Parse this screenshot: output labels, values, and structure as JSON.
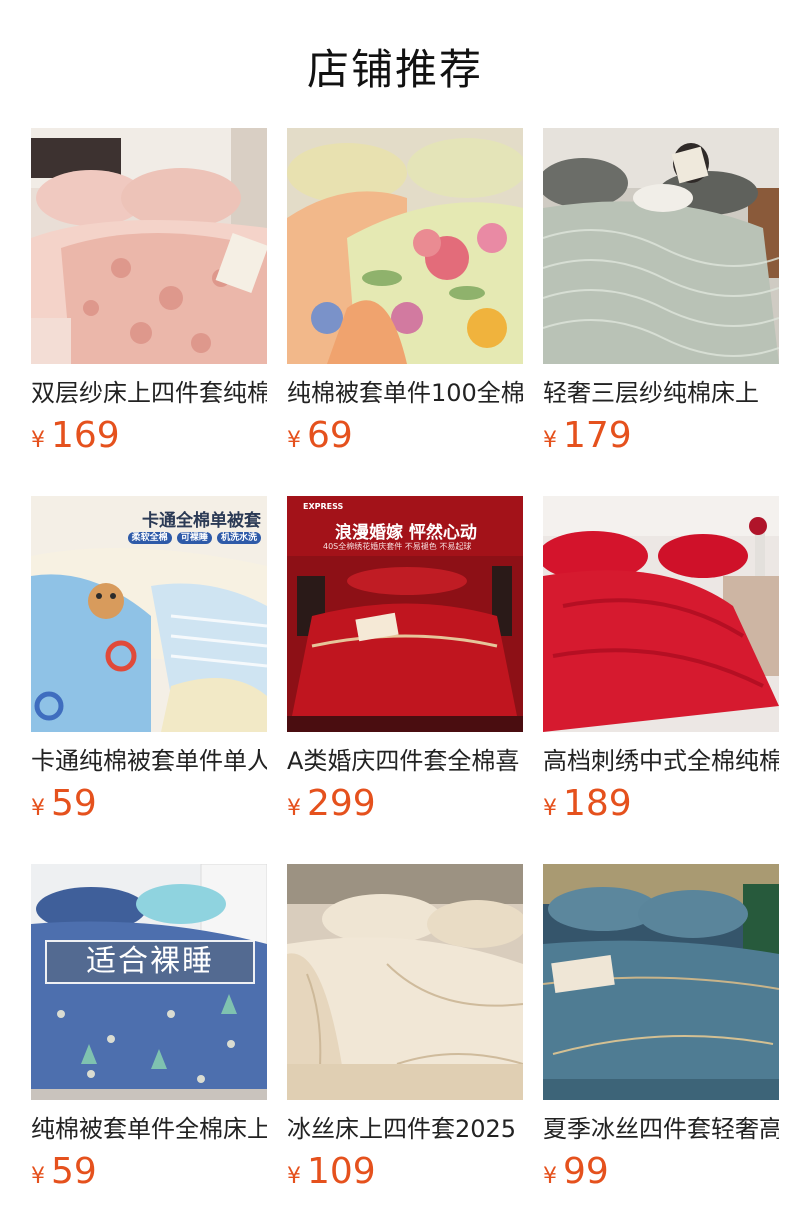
{
  "header": {
    "title": "店铺推荐"
  },
  "currency": "¥",
  "products": [
    {
      "name": "双层纱床上四件套纯棉",
      "price": "169",
      "image": "pink-floral-bedding"
    },
    {
      "name": "纯棉被套单件100全棉",
      "price": "69",
      "image": "yellow-floral-bedding"
    },
    {
      "name": "轻奢三层纱纯棉床上",
      "price": "179",
      "image": "sage-green-bedding"
    },
    {
      "name": "卡通纯棉被套单件单人",
      "price": "59",
      "image": "cartoon-blue-bedding",
      "banner": {
        "title": "卡通全棉单被套",
        "tags": [
          "柔软全棉",
          "可裸睡",
          "机洗水洗"
        ]
      }
    },
    {
      "name": "A类婚庆四件套全棉喜",
      "price": "299",
      "image": "red-wedding-bedding",
      "banner": {
        "title": "浪漫婚嫁 怦然心动",
        "subtitle": "40S全棉绣花婚庆套件 不易褪色 不易起球",
        "logo": "EXPRESS"
      }
    },
    {
      "name": "高档刺绣中式全棉纯棉",
      "price": "189",
      "image": "red-silk-bedding"
    },
    {
      "name": "纯棉被套单件全棉床上",
      "price": "59",
      "image": "blue-printed-bedding",
      "badge": "适合裸睡"
    },
    {
      "name": "冰丝床上四件套2025",
      "price": "109",
      "image": "champagne-silk-bedding"
    },
    {
      "name": "夏季冰丝四件套轻奢高",
      "price": "99",
      "image": "teal-silk-bedding"
    }
  ]
}
